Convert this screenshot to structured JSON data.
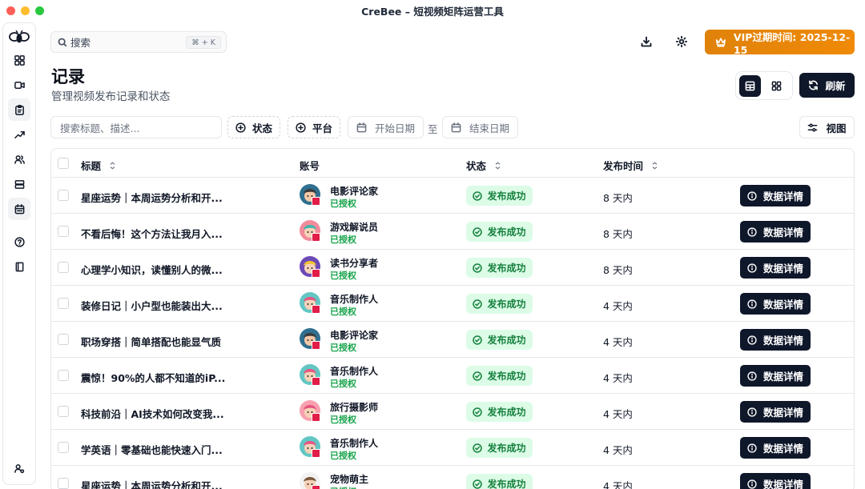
{
  "window": {
    "title": "CreBee – 短视频矩阵运营工具"
  },
  "search": {
    "placeholder": "搜索",
    "shortcut": "⌘ + K"
  },
  "vip": {
    "label": "VIP过期时间: 2025-12-15",
    "color": "#f08a08"
  },
  "page": {
    "title": "记录",
    "subtitle": "管理视频发布记录和状态"
  },
  "actions": {
    "refresh": "刷新",
    "view": "视图"
  },
  "filters": {
    "search_placeholder": "搜索标题、描述...",
    "status": "状态",
    "platform": "平台",
    "start_date": "开始日期",
    "to": "至",
    "end_date": "结束日期"
  },
  "table": {
    "columns": [
      "标题",
      "账号",
      "状态",
      "发布时间"
    ],
    "rows": [
      {
        "title": "星座运势｜本周运势分析和开...",
        "account": "电影评论家",
        "auth": "已授权",
        "status": "发布成功",
        "time": "8 天内",
        "action": "数据详情"
      },
      {
        "title": "不看后悔！这个方法让我月入...",
        "account": "游戏解说员",
        "auth": "已授权",
        "status": "发布成功",
        "time": "8 天内",
        "action": "数据详情"
      },
      {
        "title": "心理学小知识，读懂别人的微...",
        "account": "读书分享者",
        "auth": "已授权",
        "status": "发布成功",
        "time": "8 天内",
        "action": "数据详情"
      },
      {
        "title": "装修日记｜小户型也能装出大...",
        "account": "音乐制作人",
        "auth": "已授权",
        "status": "发布成功",
        "time": "4 天内",
        "action": "数据详情"
      },
      {
        "title": "职场穿搭｜简单搭配也能显气质",
        "account": "电影评论家",
        "auth": "已授权",
        "status": "发布成功",
        "time": "4 天内",
        "action": "数据详情"
      },
      {
        "title": "震惊！90%的人都不知道的iP...",
        "account": "音乐制作人",
        "auth": "已授权",
        "status": "发布成功",
        "time": "4 天内",
        "action": "数据详情"
      },
      {
        "title": "科技前沿｜AI技术如何改变我...",
        "account": "旅行摄影师",
        "auth": "已授权",
        "status": "发布成功",
        "time": "4 天内",
        "action": "数据详情"
      },
      {
        "title": "学英语｜零基础也能快速入门...",
        "account": "音乐制作人",
        "auth": "已授权",
        "status": "发布成功",
        "time": "4 天内",
        "action": "数据详情"
      },
      {
        "title": "星座运势｜本周运势分析和开...",
        "account": "宠物萌主",
        "auth": "已授权",
        "status": "发布成功",
        "time": "4 天内",
        "action": "数据详情"
      }
    ]
  },
  "sidebar": {
    "icons": [
      "bee-logo-icon",
      "dashboard-icon",
      "video-icon",
      "clipboard-icon",
      "trending-icon",
      "users-icon",
      "storage-icon",
      "calendar-icon",
      "help-icon",
      "book-icon",
      "user-settings-icon"
    ]
  }
}
